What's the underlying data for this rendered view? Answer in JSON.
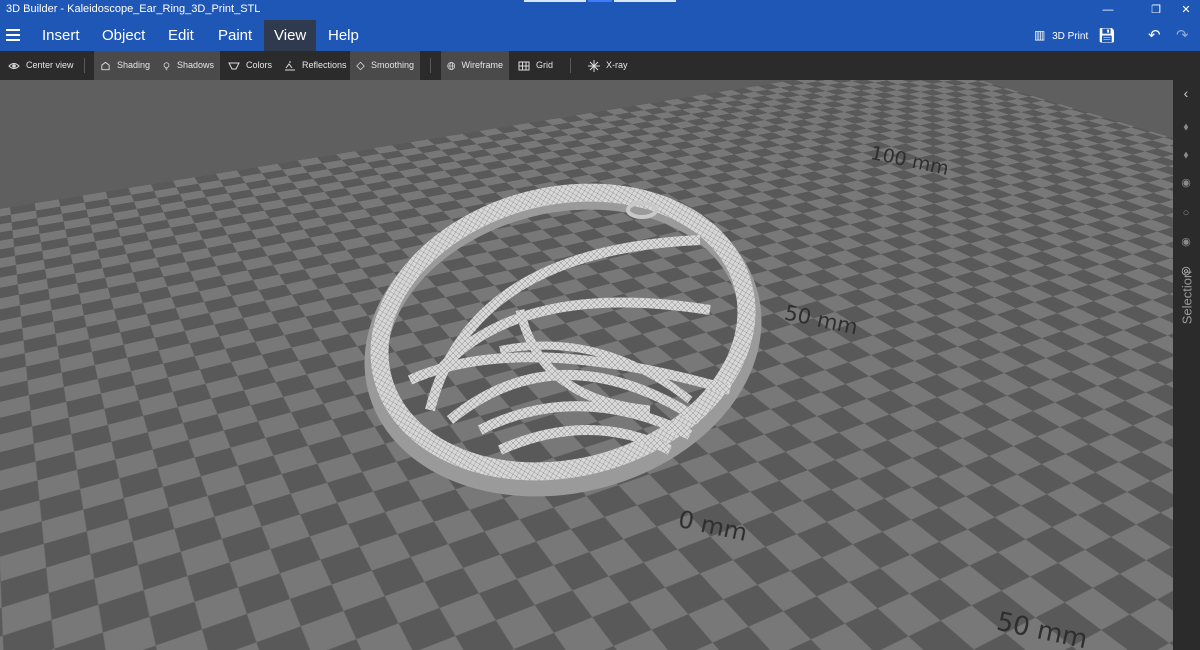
{
  "window": {
    "title": "3D Builder - Kaleidoscope_Ear_Ring_3D_Print_STL"
  },
  "menu": {
    "items": [
      "Insert",
      "Object",
      "Edit",
      "Paint",
      "View",
      "Help"
    ],
    "active": "View",
    "print_label": "3D Print"
  },
  "toolbar": {
    "center_view": "Center view",
    "shading": "Shading",
    "shadows": "Shadows",
    "colors": "Colors",
    "reflections": "Reflections",
    "smoothing": "Smoothing",
    "wireframe": "Wireframe",
    "grid": "Grid",
    "xray": "X-ray"
  },
  "scene": {
    "labels": [
      "100 mm",
      "50 mm",
      "0 mm",
      "50 mm"
    ]
  },
  "sidebar": {
    "label": "Selection"
  },
  "colors": {
    "titlebar": "#1f57b6",
    "toolbar": "#2b2b2b",
    "active_tab": "#2f3a4f"
  }
}
